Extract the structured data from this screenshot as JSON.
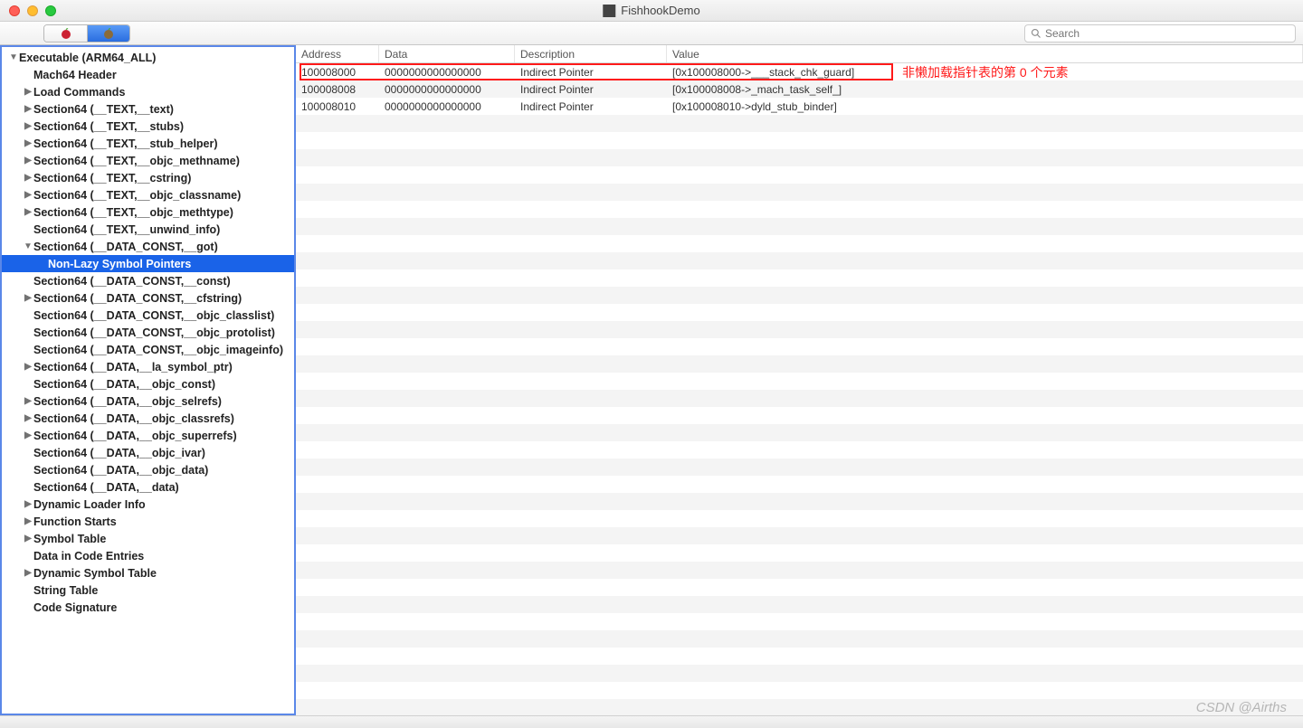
{
  "window": {
    "title": "FishhookDemo"
  },
  "toolbar": {
    "search_placeholder": "Search"
  },
  "annotation": {
    "text": "非懒加载指针表的第 0 个元素"
  },
  "watermark": {
    "text": "CSDN @Airths"
  },
  "sidebar": {
    "items": [
      {
        "label": "Executable  (ARM64_ALL)",
        "indent": 0,
        "arrow": "▼",
        "bold": true
      },
      {
        "label": "Mach64 Header",
        "indent": 1,
        "arrow": "",
        "bold": true
      },
      {
        "label": "Load Commands",
        "indent": 1,
        "arrow": "▶",
        "bold": true
      },
      {
        "label": "Section64 (__TEXT,__text)",
        "indent": 1,
        "arrow": "▶",
        "bold": true
      },
      {
        "label": "Section64 (__TEXT,__stubs)",
        "indent": 1,
        "arrow": "▶",
        "bold": true
      },
      {
        "label": "Section64 (__TEXT,__stub_helper)",
        "indent": 1,
        "arrow": "▶",
        "bold": true
      },
      {
        "label": "Section64 (__TEXT,__objc_methname)",
        "indent": 1,
        "arrow": "▶",
        "bold": true
      },
      {
        "label": "Section64 (__TEXT,__cstring)",
        "indent": 1,
        "arrow": "▶",
        "bold": true
      },
      {
        "label": "Section64 (__TEXT,__objc_classname)",
        "indent": 1,
        "arrow": "▶",
        "bold": true
      },
      {
        "label": "Section64 (__TEXT,__objc_methtype)",
        "indent": 1,
        "arrow": "▶",
        "bold": true
      },
      {
        "label": "Section64 (__TEXT,__unwind_info)",
        "indent": 1,
        "arrow": "",
        "bold": true
      },
      {
        "label": "Section64 (__DATA_CONST,__got)",
        "indent": 1,
        "arrow": "▼",
        "bold": true
      },
      {
        "label": "Non-Lazy Symbol Pointers",
        "indent": 2,
        "arrow": "",
        "bold": true,
        "selected": true
      },
      {
        "label": "Section64 (__DATA_CONST,__const)",
        "indent": 1,
        "arrow": "",
        "bold": true
      },
      {
        "label": "Section64 (__DATA_CONST,__cfstring)",
        "indent": 1,
        "arrow": "▶",
        "bold": true
      },
      {
        "label": "Section64 (__DATA_CONST,__objc_classlist)",
        "indent": 1,
        "arrow": "",
        "bold": true
      },
      {
        "label": "Section64 (__DATA_CONST,__objc_protolist)",
        "indent": 1,
        "arrow": "",
        "bold": true
      },
      {
        "label": "Section64 (__DATA_CONST,__objc_imageinfo)",
        "indent": 1,
        "arrow": "",
        "bold": true
      },
      {
        "label": "Section64 (__DATA,__la_symbol_ptr)",
        "indent": 1,
        "arrow": "▶",
        "bold": true
      },
      {
        "label": "Section64 (__DATA,__objc_const)",
        "indent": 1,
        "arrow": "",
        "bold": true
      },
      {
        "label": "Section64 (__DATA,__objc_selrefs)",
        "indent": 1,
        "arrow": "▶",
        "bold": true
      },
      {
        "label": "Section64 (__DATA,__objc_classrefs)",
        "indent": 1,
        "arrow": "▶",
        "bold": true
      },
      {
        "label": "Section64 (__DATA,__objc_superrefs)",
        "indent": 1,
        "arrow": "▶",
        "bold": true
      },
      {
        "label": "Section64 (__DATA,__objc_ivar)",
        "indent": 1,
        "arrow": "",
        "bold": true
      },
      {
        "label": "Section64 (__DATA,__objc_data)",
        "indent": 1,
        "arrow": "",
        "bold": true
      },
      {
        "label": "Section64 (__DATA,__data)",
        "indent": 1,
        "arrow": "",
        "bold": true
      },
      {
        "label": "Dynamic Loader Info",
        "indent": 1,
        "arrow": "▶",
        "bold": true
      },
      {
        "label": "Function Starts",
        "indent": 1,
        "arrow": "▶",
        "bold": true
      },
      {
        "label": "Symbol Table",
        "indent": 1,
        "arrow": "▶",
        "bold": true
      },
      {
        "label": "Data in Code Entries",
        "indent": 1,
        "arrow": "",
        "bold": true
      },
      {
        "label": "Dynamic Symbol Table",
        "indent": 1,
        "arrow": "▶",
        "bold": true
      },
      {
        "label": "String Table",
        "indent": 1,
        "arrow": "",
        "bold": true
      },
      {
        "label": "Code Signature",
        "indent": 1,
        "arrow": "",
        "bold": true
      }
    ]
  },
  "table": {
    "headers": {
      "address": "Address",
      "data": "Data",
      "description": "Description",
      "value": "Value"
    },
    "rows": [
      {
        "address": "100008000",
        "data": "0000000000000000",
        "description": "Indirect Pointer",
        "value": "[0x100008000->___stack_chk_guard]"
      },
      {
        "address": "100008008",
        "data": "0000000000000000",
        "description": "Indirect Pointer",
        "value": "[0x100008008->_mach_task_self_]"
      },
      {
        "address": "100008010",
        "data": "0000000000000000",
        "description": "Indirect Pointer",
        "value": "[0x100008010->dyld_stub_binder]"
      }
    ],
    "empty_rows": 36
  }
}
